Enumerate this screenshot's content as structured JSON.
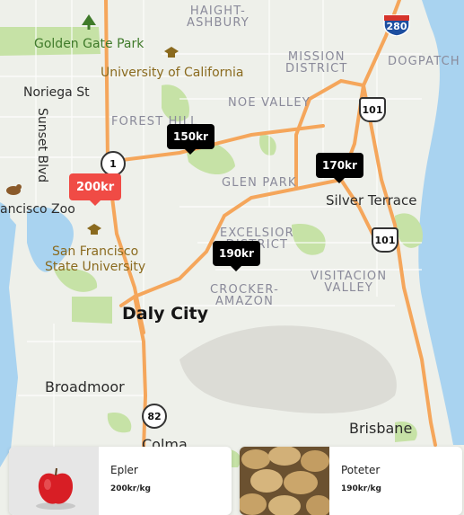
{
  "map": {
    "districts": [
      "HAIGHT-\nASHBURY",
      "MISSION\nDISTRICT",
      "DOGPATCH",
      "NOE VALLEY",
      "FOREST HILL",
      "GLEN PARK",
      "EXCELSIOR\nDISTRICT",
      "CROCKER-\nAMAZON",
      "VISITACION\nVALLEY"
    ],
    "places": {
      "golden_gate_park": "Golden Gate Park",
      "uc": "University of California",
      "noriega": "Noriega St",
      "sunset": "Sunset Blvd",
      "zoo": "ancisco Zoo",
      "sfsu": "San Francisco\nState University",
      "silver_terrace": "Silver Terrace",
      "daly_city": "Daly City",
      "broadmoor": "Broadmoor",
      "brisbane": "Brisbane",
      "colma": "Colma"
    },
    "routes": [
      "280",
      "101",
      "101",
      "1",
      "82"
    ],
    "icons": [
      "tree-icon",
      "university-icon",
      "zoo-icon"
    ]
  },
  "markers": [
    {
      "label": "150kr",
      "color": "#000000"
    },
    {
      "label": "170kr",
      "color": "#000000"
    },
    {
      "label": "200kr",
      "color": "#f04b45"
    },
    {
      "label": "190kr",
      "color": "#000000"
    }
  ],
  "products": [
    {
      "name": "Epler",
      "price": "200kr/kg",
      "image": "apple-image"
    },
    {
      "name": "Poteter",
      "price": "190kr/kg",
      "image": "potatoes-image"
    }
  ],
  "colors": {
    "highway": "#f5a65b",
    "park": "#c6e2a6",
    "water": "#a9d3f0",
    "land": "#eef0ea",
    "selected_marker": "#f04b45"
  }
}
